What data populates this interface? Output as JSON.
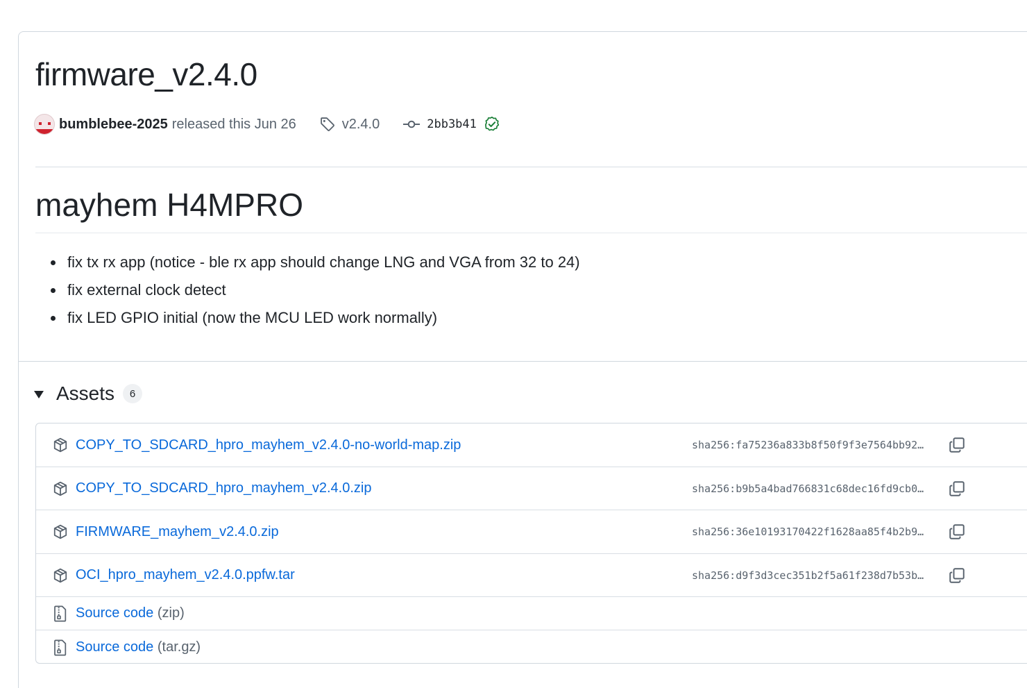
{
  "release": {
    "title": "firmware_v2.4.0",
    "author": "bumblebee-2025",
    "released_text": "released this Jun 26",
    "tag": "v2.4.0",
    "commit": "2bb3b41"
  },
  "notes": {
    "heading": "mayhem H4MPRO",
    "items": [
      "fix tx rx app (notice - ble rx app should change LNG and VGA from 32 to 24)",
      "fix external clock detect",
      "fix LED GPIO initial (now the MCU LED work normally)"
    ]
  },
  "assets": {
    "title": "Assets",
    "count": "6",
    "files": [
      {
        "name": "COPY_TO_SDCARD_hpro_mayhem_v2.4.0-no-world-map.zip",
        "sha": "sha256:fa75236a833b8f50f9f3e7564bb92…"
      },
      {
        "name": "COPY_TO_SDCARD_hpro_mayhem_v2.4.0.zip",
        "sha": "sha256:b9b5a4bad766831c68dec16fd9cb0…"
      },
      {
        "name": "FIRMWARE_mayhem_v2.4.0.zip",
        "sha": "sha256:36e10193170422f1628aa85f4b2b9…"
      },
      {
        "name": "OCI_hpro_mayhem_v2.4.0.ppfw.tar",
        "sha": "sha256:d9f3d3cec351b2f5a61f238d7b53b…"
      }
    ],
    "source": [
      {
        "label": "Source code",
        "suffix": "(zip)"
      },
      {
        "label": "Source code",
        "suffix": "(tar.gz)"
      }
    ]
  },
  "icons": {
    "tag": "tag-icon",
    "commit": "git-commit-icon",
    "verified": "verified-check-icon",
    "package": "package-icon",
    "copy": "copy-icon",
    "file_zip": "file-zip-icon"
  },
  "colors": {
    "link": "#0969da",
    "verified": "#1a7f37",
    "border": "#d0d7de"
  }
}
